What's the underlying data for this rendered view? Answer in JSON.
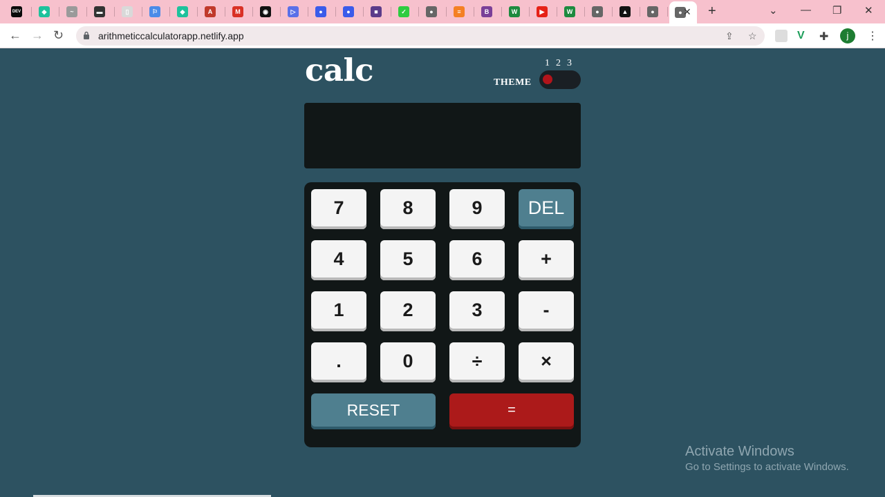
{
  "browser": {
    "tabs": [
      {
        "icon": "dev-icon",
        "color": "#0a0a0a",
        "glyph": "DEV"
      },
      {
        "icon": "diamond-icon",
        "color": "#1ec29c",
        "glyph": "◆"
      },
      {
        "icon": "pen-icon",
        "color": "#9a9a9a",
        "glyph": "~"
      },
      {
        "icon": "folder-icon",
        "color": "#333333",
        "glyph": "▬"
      },
      {
        "icon": "page-icon",
        "color": "#d9d9d9",
        "glyph": "▯"
      },
      {
        "icon": "flag-icon",
        "color": "#4a8be8",
        "glyph": "⚐"
      },
      {
        "icon": "diamond-icon",
        "color": "#1ec29c",
        "glyph": "◆"
      },
      {
        "icon": "a-icon",
        "color": "#c0392b",
        "glyph": "A"
      },
      {
        "icon": "gmail-icon",
        "color": "#d93025",
        "glyph": "M"
      },
      {
        "icon": "github-icon",
        "color": "#111111",
        "glyph": "◉"
      },
      {
        "icon": "play-icon",
        "color": "#5a70e8",
        "glyph": "▷"
      },
      {
        "icon": "circle-icon",
        "color": "#3b5bea",
        "glyph": "●"
      },
      {
        "icon": "circle-icon",
        "color": "#3b5bea",
        "glyph": "●"
      },
      {
        "icon": "colorful-icon",
        "color": "#5b3b8a",
        "glyph": "■"
      },
      {
        "icon": "check-icon",
        "color": "#2ecc40",
        "glyph": "✓"
      },
      {
        "icon": "globe-icon",
        "color": "#666666",
        "glyph": "●"
      },
      {
        "icon": "stack-icon",
        "color": "#f48024",
        "glyph": "≡"
      },
      {
        "icon": "b-icon",
        "color": "#7a3f98",
        "glyph": "B"
      },
      {
        "icon": "w-icon",
        "color": "#1d8a3f",
        "glyph": "W"
      },
      {
        "icon": "youtube-icon",
        "color": "#e62117",
        "glyph": "▶"
      },
      {
        "icon": "w-icon",
        "color": "#1d8a3f",
        "glyph": "W"
      },
      {
        "icon": "globe-icon",
        "color": "#666666",
        "glyph": "●"
      },
      {
        "icon": "a-icon",
        "color": "#111111",
        "glyph": "▲"
      },
      {
        "icon": "globe-icon",
        "color": "#666666",
        "glyph": "●"
      },
      {
        "icon": "globe-icon",
        "color": "#666666",
        "glyph": "●"
      }
    ],
    "url": "arithmeticcalculatorapp.netlify.app",
    "profile_initial": "j"
  },
  "app": {
    "logo": "calc",
    "theme_label": "THEME",
    "theme_options": [
      "1",
      "2",
      "3"
    ],
    "active_theme": 1,
    "display_value": "",
    "colors": {
      "background": "#2d5261",
      "panel": "#111717",
      "key": "#f4f4f4",
      "function_key": "#4f7f8f",
      "equals_key": "#ac1a1a"
    }
  },
  "keys": {
    "row1": [
      "7",
      "8",
      "9",
      "DEL"
    ],
    "row2": [
      "4",
      "5",
      "6",
      "+"
    ],
    "row3": [
      "1",
      "2",
      "3",
      "-"
    ],
    "row4": [
      ".",
      "0",
      "÷",
      "×"
    ],
    "reset": "RESET",
    "equals": "="
  },
  "os": {
    "watermark_title": "Activate Windows",
    "watermark_sub": "Go to Settings to activate Windows."
  }
}
